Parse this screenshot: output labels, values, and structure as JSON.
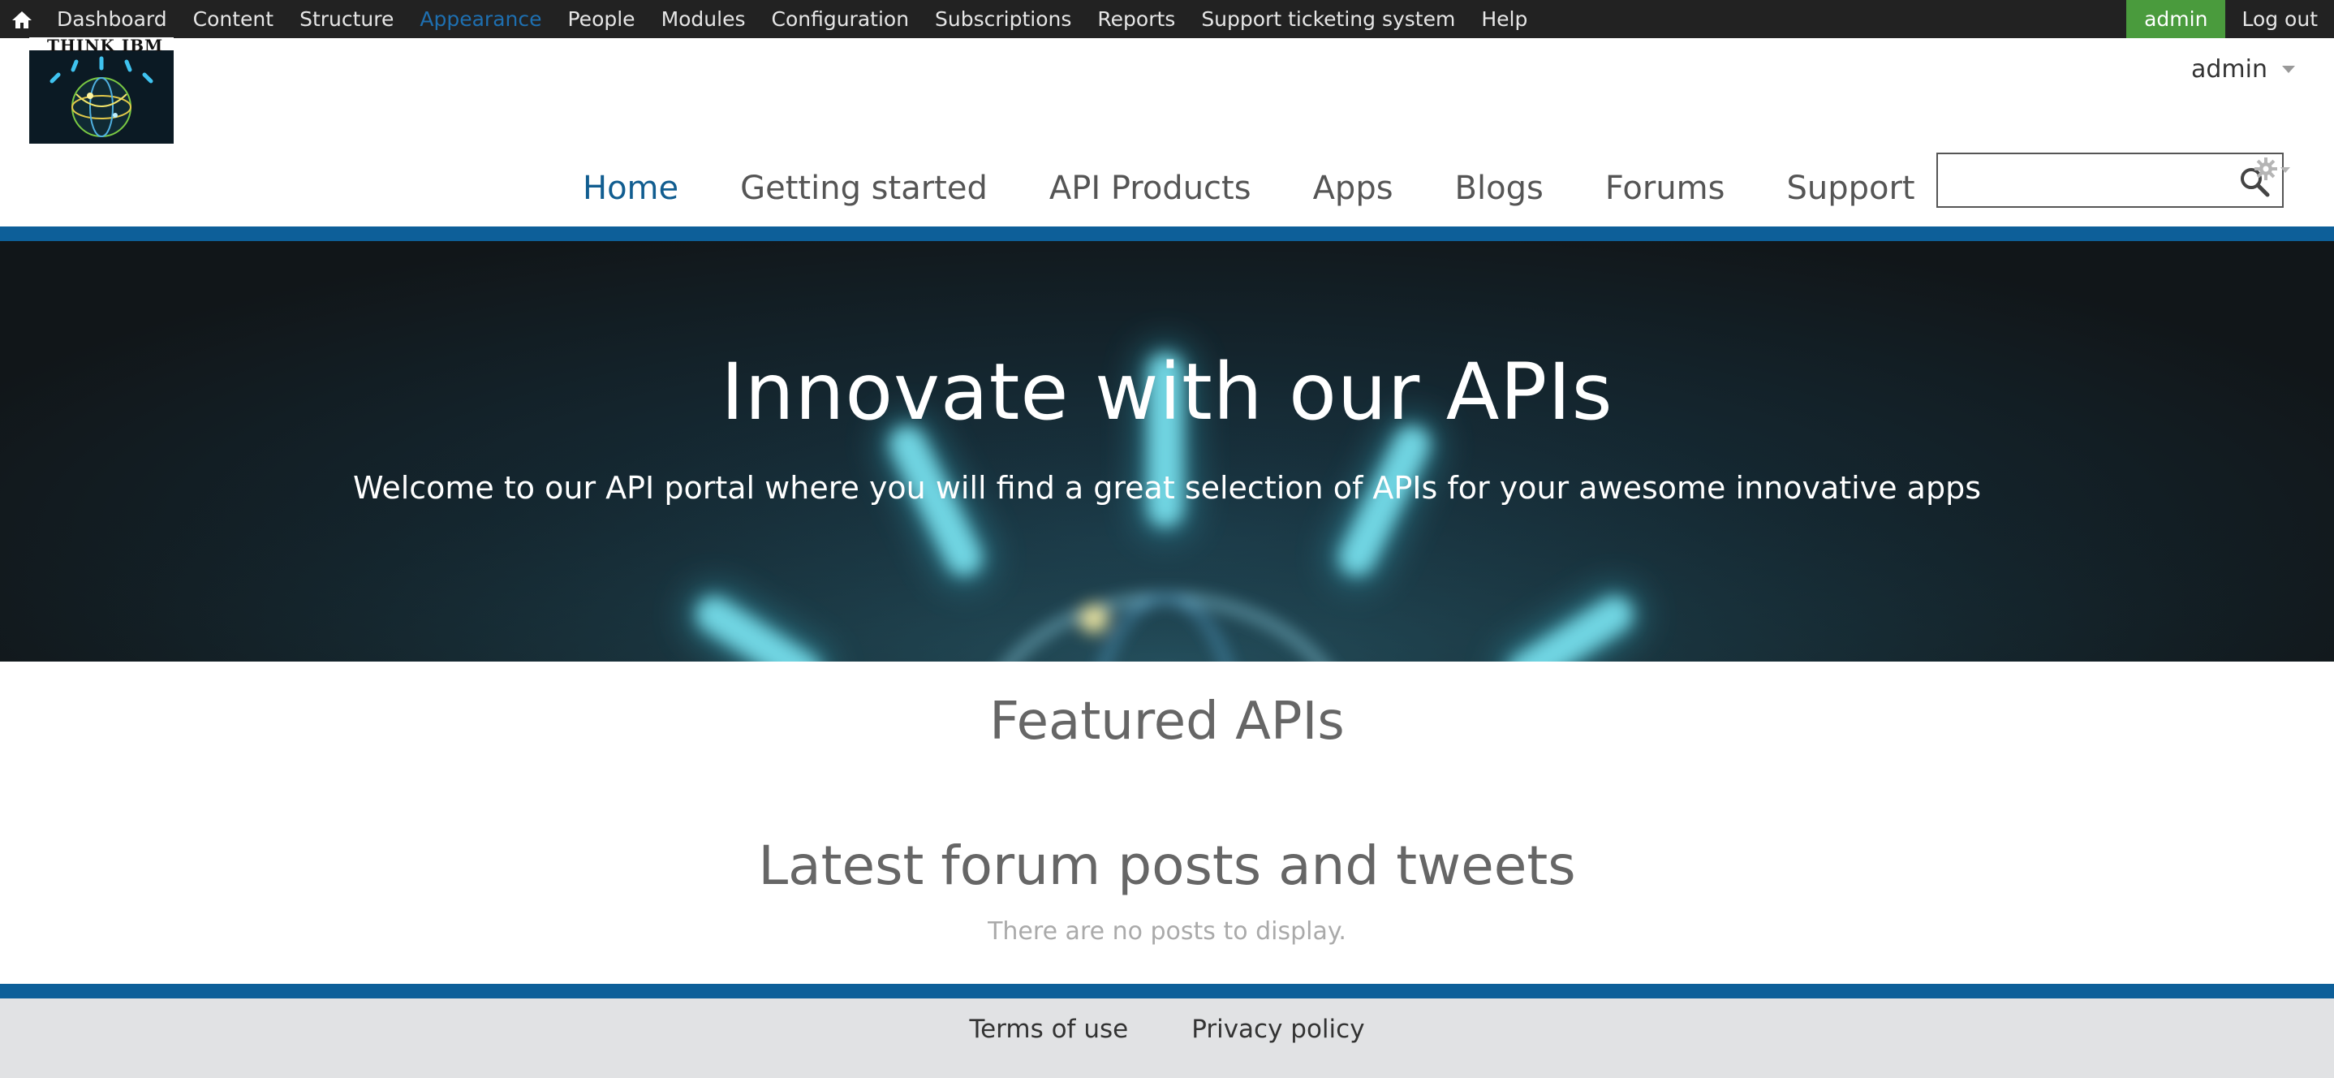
{
  "admin_toolbar": {
    "home_icon": "home-icon",
    "items": [
      {
        "label": "Dashboard"
      },
      {
        "label": "Content"
      },
      {
        "label": "Structure"
      },
      {
        "label": "Appearance"
      },
      {
        "label": "People"
      },
      {
        "label": "Modules"
      },
      {
        "label": "Configuration"
      },
      {
        "label": "Subscriptions"
      },
      {
        "label": "Reports"
      },
      {
        "label": "Support ticketing system"
      },
      {
        "label": "Help"
      }
    ],
    "active_index": 3,
    "user_label": "admin",
    "logout_label": "Log out",
    "user_color": "#4a9b3d"
  },
  "header": {
    "logo_text": "THINK IBM",
    "user_menu_label": "admin",
    "search": {
      "value": "",
      "placeholder": ""
    }
  },
  "main_nav": {
    "items": [
      {
        "label": "Home"
      },
      {
        "label": "Getting started"
      },
      {
        "label": "API Products"
      },
      {
        "label": "Apps"
      },
      {
        "label": "Blogs"
      },
      {
        "label": "Forums"
      },
      {
        "label": "Support"
      }
    ],
    "active_index": 0,
    "accent_color": "#115d90"
  },
  "hero": {
    "title": "Innovate with our APIs",
    "subtitle": "Welcome to our API portal where you will find a great selection of APIs for your awesome innovative apps"
  },
  "featured": {
    "title": "Featured APIs"
  },
  "forum": {
    "title": "Latest forum posts and tweets",
    "empty_text": "There are no posts to display."
  },
  "footer": {
    "links": [
      {
        "label": "Terms of use"
      },
      {
        "label": "Privacy policy"
      }
    ]
  },
  "colors": {
    "brand_blue": "#0d5f99",
    "toolbar_bg": "#222222",
    "footer_bg": "#e1e2e4"
  }
}
